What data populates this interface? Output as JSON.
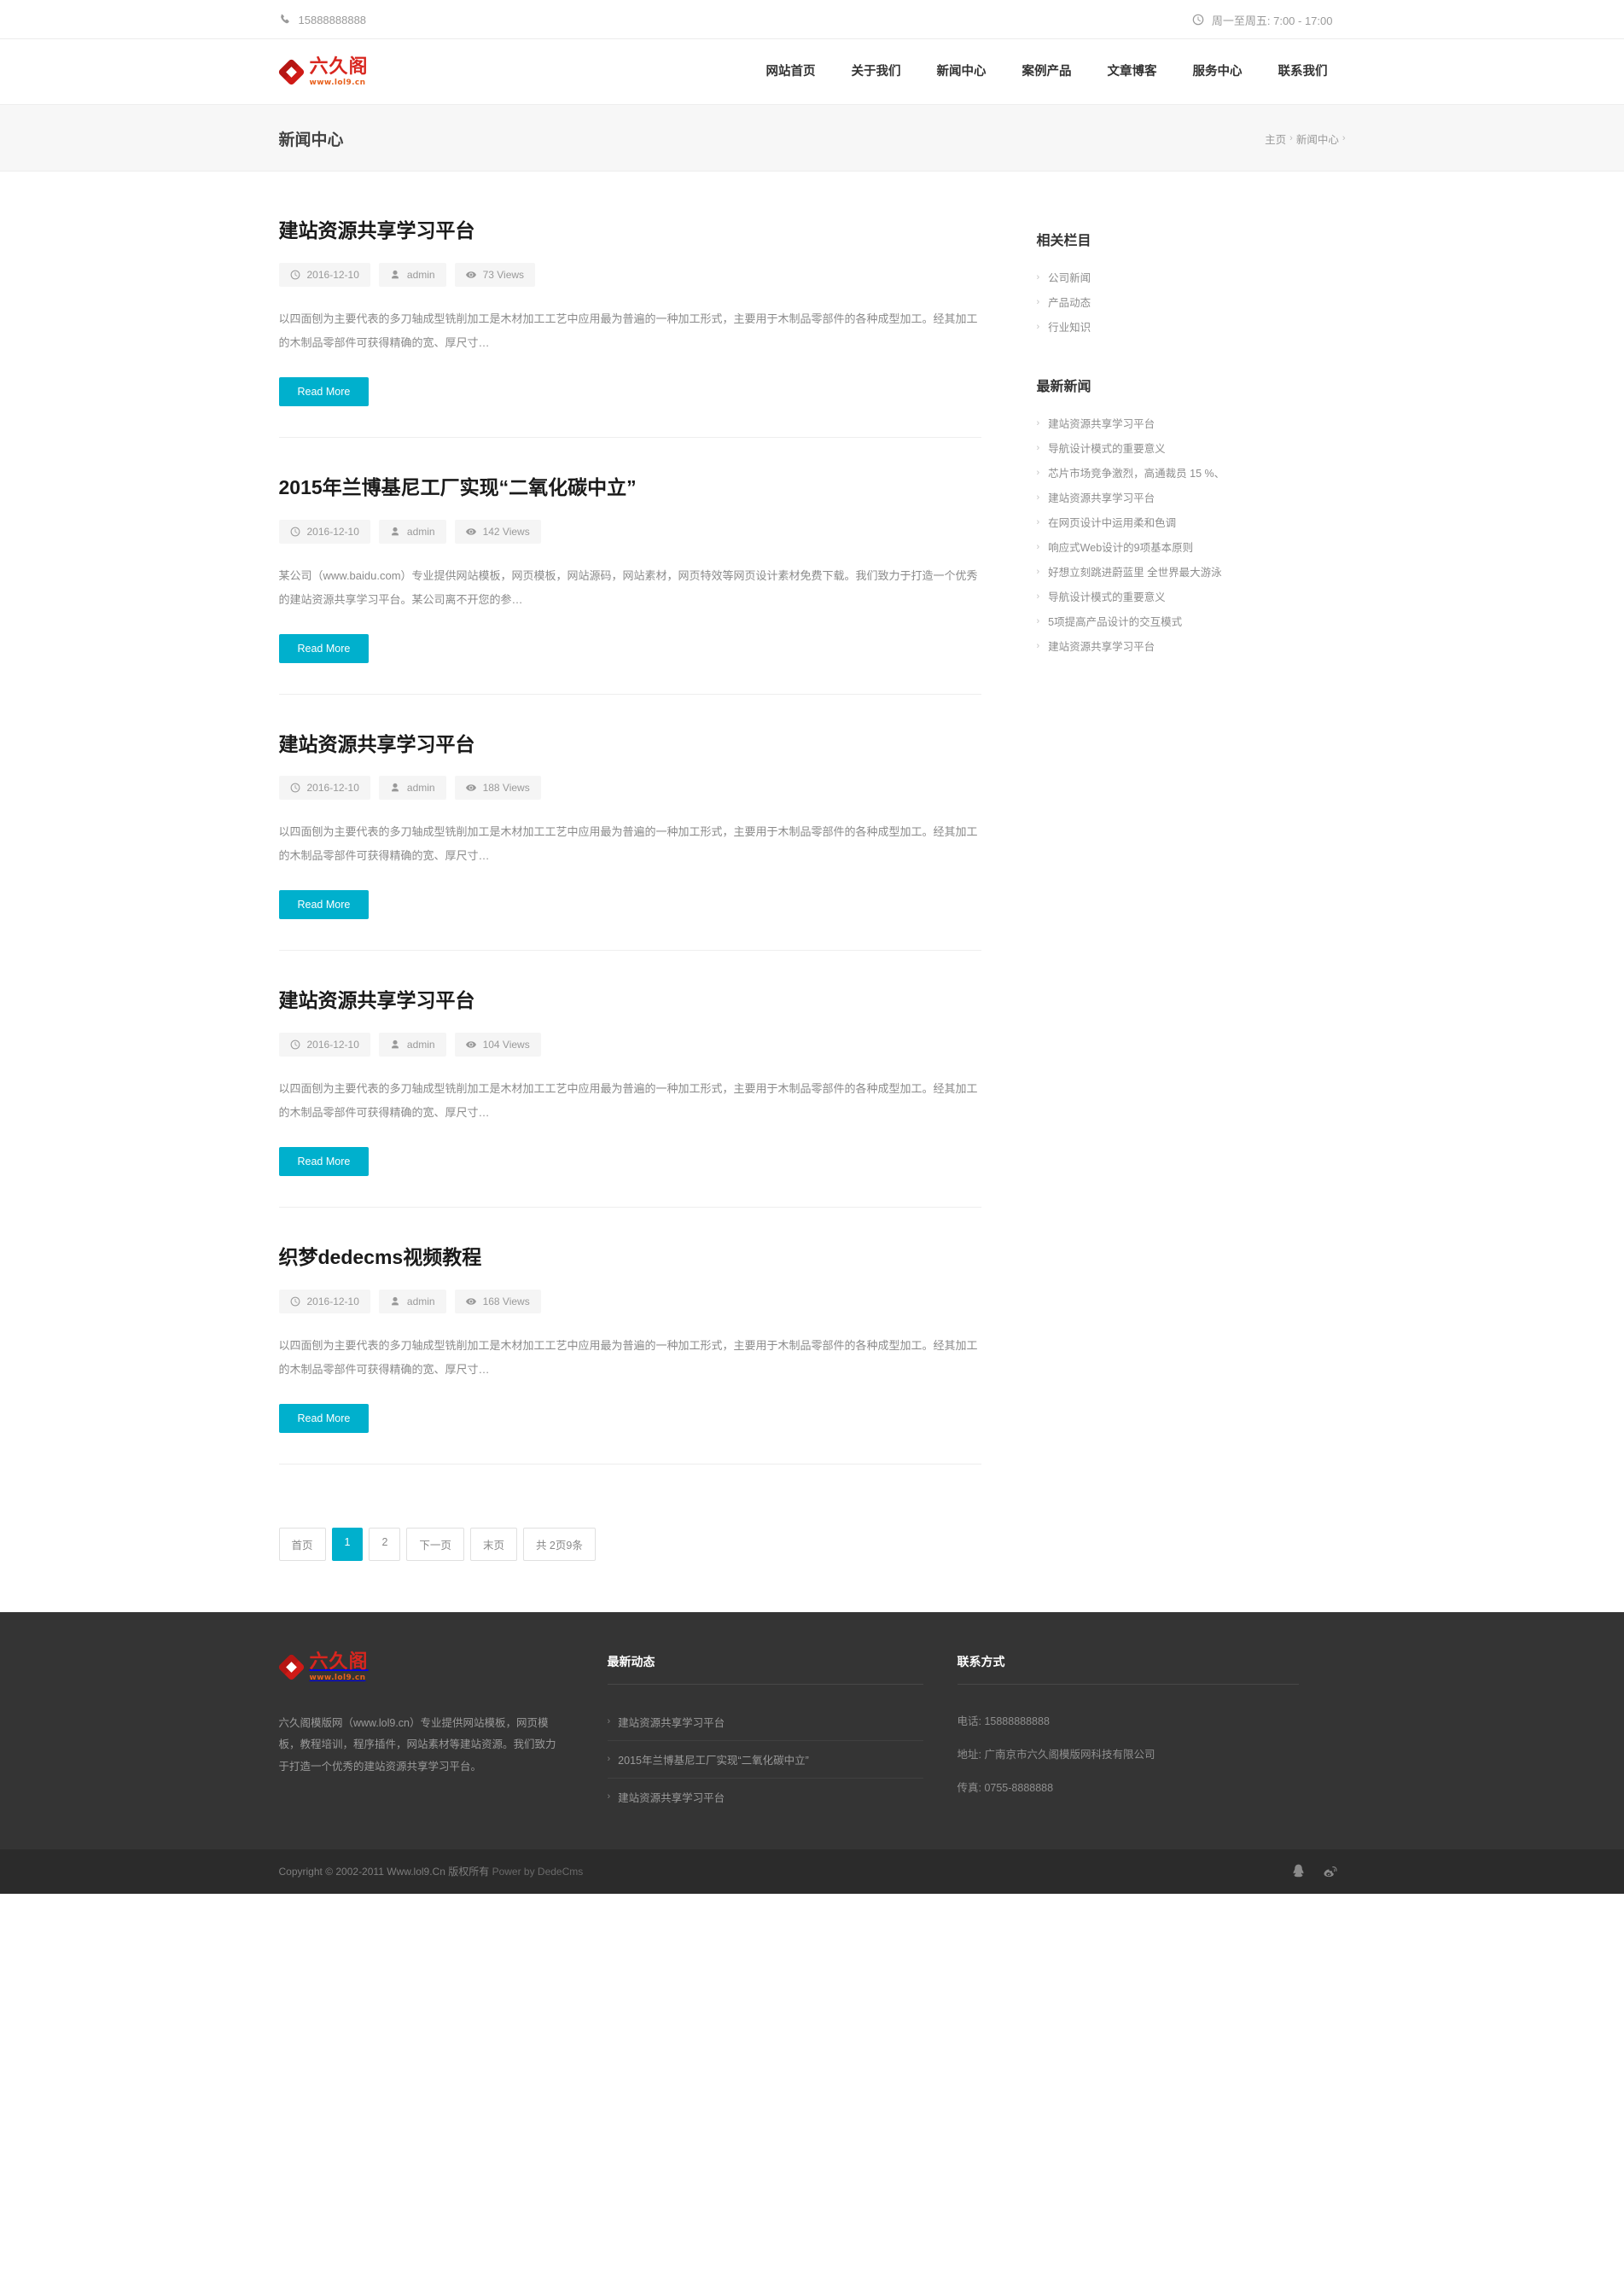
{
  "topbar": {
    "phone": "15888888888",
    "hours": "周一至周五: 7:00 - 17:00"
  },
  "brand": {
    "name_cn": "六久阁",
    "url": "www.lol9.cn"
  },
  "nav": {
    "items": [
      {
        "label": "网站首页"
      },
      {
        "label": "关于我们"
      },
      {
        "label": "新闻中心"
      },
      {
        "label": "案例产品"
      },
      {
        "label": "文章博客"
      },
      {
        "label": "服务中心"
      },
      {
        "label": "联系我们"
      }
    ]
  },
  "banner": {
    "title": "新闻中心",
    "crumb_home": "主页",
    "crumb_current": "新闻中心",
    "sep": "›"
  },
  "articles": [
    {
      "title": "建站资源共享学习平台",
      "date": "2016-12-10",
      "author": "admin",
      "views": "73 Views",
      "excerpt": "以四面刨为主要代表的多刀轴成型铣削加工是木材加工工艺中应用最为普遍的一种加工形式，主要用于木制品零部件的各种成型加工。经其加工的木制品零部件可获得精确的宽、厚尺寸…",
      "more": "Read More"
    },
    {
      "title": "2015年兰博基尼工厂实现“二氧化碳中立”",
      "date": "2016-12-10",
      "author": "admin",
      "views": "142 Views",
      "excerpt": "某公司（www.baidu.com）专业提供网站模板，网页模板，网站源码，网站素材，网页特效等网页设计素材免费下载。我们致力于打造一个优秀的建站资源共享学习平台。某公司离不开您的参…",
      "more": "Read More"
    },
    {
      "title": "建站资源共享学习平台",
      "date": "2016-12-10",
      "author": "admin",
      "views": "188 Views",
      "excerpt": "以四面刨为主要代表的多刀轴成型铣削加工是木材加工工艺中应用最为普遍的一种加工形式，主要用于木制品零部件的各种成型加工。经其加工的木制品零部件可获得精确的宽、厚尺寸…",
      "more": "Read More"
    },
    {
      "title": "建站资源共享学习平台",
      "date": "2016-12-10",
      "author": "admin",
      "views": "104 Views",
      "excerpt": "以四面刨为主要代表的多刀轴成型铣削加工是木材加工工艺中应用最为普遍的一种加工形式，主要用于木制品零部件的各种成型加工。经其加工的木制品零部件可获得精确的宽、厚尺寸…",
      "more": "Read More"
    },
    {
      "title": "织梦dedecms视频教程",
      "date": "2016-12-10",
      "author": "admin",
      "views": "168 Views",
      "excerpt": "以四面刨为主要代表的多刀轴成型铣削加工是木材加工工艺中应用最为普遍的一种加工形式，主要用于木制品零部件的各种成型加工。经其加工的木制品零部件可获得精确的宽、厚尺寸…",
      "more": "Read More"
    }
  ],
  "pager": {
    "first": "首页",
    "p1": "1",
    "p2": "2",
    "next": "下一页",
    "last": "末页",
    "total": "共 2页9条"
  },
  "sidebar": {
    "cat_title": "相关栏目",
    "categories": [
      {
        "label": "公司新闻"
      },
      {
        "label": "产品动态"
      },
      {
        "label": "行业知识"
      }
    ],
    "news_title": "最新新闻",
    "news": [
      {
        "label": "建站资源共享学习平台"
      },
      {
        "label": "导航设计模式的重要意义"
      },
      {
        "label": "芯片市场竞争激烈，高通裁员 15 %、"
      },
      {
        "label": "建站资源共享学习平台"
      },
      {
        "label": "在网页设计中运用柔和色调"
      },
      {
        "label": "响应式Web设计的9项基本原则"
      },
      {
        "label": "好想立刻跳进蔚蓝里 全世界最大游泳"
      },
      {
        "label": "导航设计模式的重要意义"
      },
      {
        "label": "5项提高产品设计的交互模式"
      },
      {
        "label": "建站资源共享学习平台"
      }
    ],
    "arrow": "›"
  },
  "footer": {
    "desc": "六久阁模版网（www.lol9.cn）专业提供网站模板，网页模板，教程培训，程序插件，网站素材等建站资源。我们致力于打造一个优秀的建站资源共享学习平台。",
    "news_title": "最新动态",
    "news": [
      {
        "label": "建站资源共享学习平台"
      },
      {
        "label": "2015年兰博基尼工厂实现“二氧化碳中立”"
      },
      {
        "label": "建站资源共享学习平台"
      }
    ],
    "contact_title": "联系方式",
    "contacts": [
      {
        "label": "电话: 15888888888"
      },
      {
        "label": "地址: 广南京市六久阁模版网科技有限公司"
      },
      {
        "label": "传真: 0755-8888888"
      }
    ],
    "arrow": "›"
  },
  "copyright": {
    "text": "Copyright © 2002-2011 Www.lol9.Cn 版权所有",
    "power": "Power by DedeCms"
  }
}
